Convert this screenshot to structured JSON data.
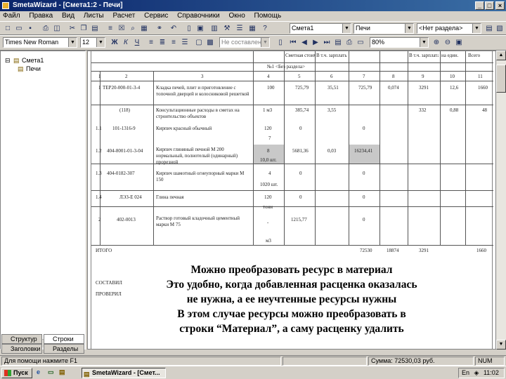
{
  "window": {
    "title": "SmetaWizard - [Смета1:2 - Печи]",
    "caption_buttons": [
      "_",
      "□",
      "×"
    ]
  },
  "menu": [
    "Файл",
    "Правка",
    "Вид",
    "Листы",
    "Расчет",
    "Сервис",
    "Справочники",
    "Окно",
    "Помощь"
  ],
  "toolbar": {
    "estimate_combo": "Смета1",
    "section_combo": "Печи",
    "section_filter_combo": "<Нет раздела>",
    "font_combo": "Times New Roman",
    "size_combo": "12",
    "bold": "Ж",
    "italic": "К",
    "underline": "Ч",
    "style_combo": "Не составленные",
    "zoom_combo": "80%"
  },
  "tree": {
    "root": "Смета1",
    "child": "Печи"
  },
  "left_tabs": [
    "Структур",
    "Строки",
    "Заголовки",
    "Разделы"
  ],
  "sheet": {
    "header_cells": [
      "Сметная стоимость",
      "В т.ч. зарплаты",
      "В т.ч. зарплата",
      "на един.",
      "Всего"
    ],
    "section_label": "№1 <Без раздела>",
    "col_numbers": [
      "1",
      "2",
      "3",
      "4",
      "5",
      "6",
      "7",
      "8",
      "9",
      "10",
      "11"
    ],
    "rows": [
      {
        "n": "1",
        "code": "ТЕР20-000-01-3-4",
        "name": "Кладка печей, плит и приготовление с топочной дверцей и колосниковой решеткой",
        "qty": "100",
        "price": "725,79",
        "c6": "35,51",
        "c7": "725,79",
        "c8": "0,074",
        "c9": "3291",
        "c10": "12,6",
        "c11": "1660"
      },
      {
        "n": "",
        "code": "(118)",
        "name": "Консультационные расходы в сметах на строительство объектов",
        "qty": "1 м3",
        "price": "385,74",
        "c6": "3,55",
        "c7": "",
        "c8": "",
        "c9": "332",
        "c10": "0,88",
        "c11": "48"
      },
      {
        "n": "1.1",
        "code": "101-1316-9",
        "name": "Кирпич красный обычный",
        "qty": "120",
        "qty2": "7",
        "price": "0",
        "c6": "",
        "c7": "0",
        "c8": "",
        "c9": "",
        "c10": "",
        "c11": ""
      },
      {
        "n": "1.2",
        "code": "404-8001-01-3-04",
        "name": "Кирпич глиняный печной М 200 нормальный, полнотелый (одинарный) прорезной",
        "qty": "8",
        "qty2": "10,0 шт.",
        "price": "5681,36",
        "c6": "0,03",
        "c7": "16234,41",
        "c8": "",
        "c9": "",
        "c10": "",
        "c11": ""
      },
      {
        "n": "1.3",
        "code": "404-0182-307",
        "name": "Кирпич шамотный огнеупорный марки М 150",
        "qty": "4",
        "qty2": "1020 шт.",
        "price": "0",
        "c6": "",
        "c7": "0",
        "c8": "",
        "c9": "",
        "c10": "",
        "c11": ""
      },
      {
        "n": "1.4",
        "code": "ЛЭ3-Е 024",
        "name": "Глина печная",
        "qty": "120",
        "qty2": "тонн",
        "price": "0",
        "c6": "",
        "c7": "0",
        "c8": "",
        "c9": "",
        "c10": "",
        "c11": ""
      },
      {
        "n": "2",
        "code": "402-0013",
        "name": "Раствор готовый кладочный цементный марки М 75",
        "qty": "-",
        "qty2": "м3",
        "price": "1215,77",
        "c6": "",
        "c7": "0",
        "c8": "",
        "c9": "",
        "c10": "",
        "c11": ""
      }
    ],
    "total": {
      "label": "ИТОГО",
      "c7": "72530",
      "c8": "18874",
      "c9": "3291",
      "c11": "1660"
    },
    "composed_label": "СОСТАВИЛ",
    "checked_label": "ПРОВЕРИЛ"
  },
  "caption": [
    "Можно преобразовать ресурс в материал",
    "Это удобно, когда добавленная расценка оказалась",
    "не нужна, а ее неучтенные ресурсы нужны",
    "В этом случае ресурсы можно преобразовать в",
    "строки “Материал”, а саму расценку удалить"
  ],
  "status": {
    "help": "Для помощи нажмите F1",
    "sum": "Сумма: 72530,03 руб.",
    "ind": "NUM"
  },
  "taskbar": {
    "start": "Пуск",
    "task": "SmetaWizard - [Смет...",
    "lang": "En",
    "clock": "11:02"
  }
}
